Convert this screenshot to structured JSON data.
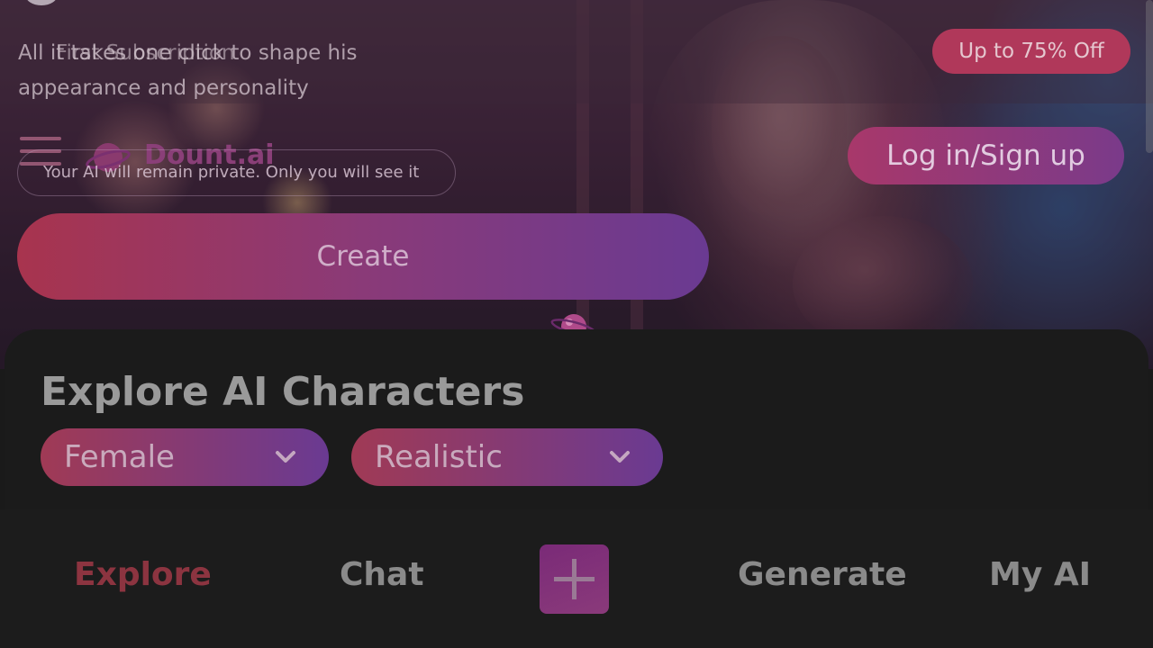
{
  "promo": {
    "text": "All it takes one click to shape his appearance and personality",
    "overlay_text": "First Subscription",
    "badge": "Up to 75% Off"
  },
  "header": {
    "logo_text": "Dount.ai",
    "login_label": "Log in/Sign up"
  },
  "creator": {
    "privacy_note": "Your AI will remain private. Only you will see it",
    "create_label": "Create"
  },
  "explore": {
    "title": "Explore AI Characters",
    "gender_filter": "Female",
    "style_filter": "Realistic"
  },
  "bottom_nav": {
    "explore": "Explore",
    "chat": "Chat",
    "generate": "Generate",
    "my_ai": "My AI",
    "add_icon": "plus-icon"
  },
  "colors": {
    "accent_start": "#a8344e",
    "accent_end": "#6a3a92",
    "active_nav": "#8c3440",
    "background": "#1a1a1a"
  }
}
